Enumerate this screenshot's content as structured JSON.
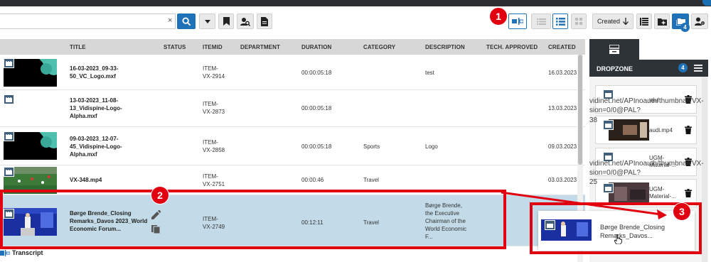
{
  "toolbar": {
    "search": {
      "value": "",
      "placeholder": ""
    },
    "created_label": "Created",
    "dropzone_count_badge": "4"
  },
  "table": {
    "columns": [
      "TITLE",
      "STATUS",
      "ITEMID",
      "DEPARTMENT",
      "DURATION",
      "CATEGORY",
      "DESCRIPTION",
      "TECH. APPROVED",
      "CREATED"
    ],
    "rows": [
      {
        "title": [
          "16-03-2023_09-33-",
          "50_VC_Logo.mxf"
        ],
        "itemid": [
          "ITEM-",
          "VX-2914"
        ],
        "duration": "00:00:05:18",
        "category": "",
        "description": [
          "test"
        ],
        "created": "16.03.2023",
        "thumb": "black-teal"
      },
      {
        "title": [
          "13-03-2023_11-08-",
          "13_Vidispine-Logo-",
          "Alpha.mxf"
        ],
        "itemid": [
          "ITEM-",
          "VX-2873"
        ],
        "duration": "00:00:05:18",
        "category": "",
        "description": [
          ""
        ],
        "created": "13.03.2023",
        "thumb": "none"
      },
      {
        "title": [
          "09-03-2023_12-07-",
          "45_Vidispine-Logo-",
          "Alpha.mxf"
        ],
        "itemid": [
          "ITEM-",
          "VX-2858"
        ],
        "duration": "00:00:05:18",
        "category": "Sports",
        "description": [
          "Logo"
        ],
        "created": "09.03.2023",
        "thumb": "black-teal"
      },
      {
        "title": [
          "VX-348.mp4"
        ],
        "itemid": [
          "ITEM-",
          "VX-2751"
        ],
        "duration": "00:00:46",
        "category": "Travel",
        "description": [
          ""
        ],
        "created": "03.03.2023",
        "thumb": "football"
      },
      {
        "title": [
          "Børge Brende_Closing",
          "Remarks_Davos 2023_World",
          "Economic Forum..."
        ],
        "itemid": [
          "ITEM-",
          "VX-2749"
        ],
        "duration": "00:12:11",
        "category": "Travel",
        "description": [
          "Børge Brende,",
          "the Executive",
          "Chairman of the",
          "World Economic",
          "F..."
        ],
        "created": "",
        "thumb": "davos"
      }
    ]
  },
  "transcript_label": "Transcript",
  "dropzone": {
    "title": "DROPZONE",
    "count": "4",
    "url_line_1": "vidinet.net/APInoauth/thumbnail/VX-",
    "url_line_2": "sion=0/0@PAL?",
    "url_line_3": "38",
    "url_line_4": "vidinet.net/APInoauth/thumbnail/VX-",
    "url_line_5": "sion=0/0@PAL?",
    "url_line_6": "25",
    "items": [
      {
        "name": [
          "test"
        ]
      },
      {
        "name": [
          "audi.mp4"
        ]
      },
      {
        "name": [
          "UGM-",
          "Material-..."
        ]
      },
      {
        "name": [
          "UGM-",
          "Material-..."
        ]
      }
    ]
  },
  "drag_ghost": {
    "name": [
      "Børge Brende_Closing",
      "Remarks_Davos..."
    ]
  },
  "annotations": [
    "1",
    "2",
    "3"
  ],
  "colors": {
    "accent": "#1f72b8",
    "highlight": "#e10010",
    "selected_row": "#c3dbe8",
    "header_dark": "#2e3338"
  }
}
